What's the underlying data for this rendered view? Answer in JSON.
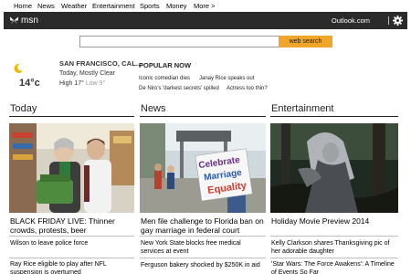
{
  "topnav": {
    "items": [
      "Home",
      "News",
      "Weather",
      "Entertainment",
      "Sports",
      "Money",
      "More >"
    ]
  },
  "header": {
    "logo_text": "msn",
    "outlook_label": "Outlook.com",
    "settings_icon": "gear-icon",
    "background_color": "#2b2b2b"
  },
  "search": {
    "placeholder": "",
    "button_label": "web search",
    "button_color": "#f0a62a"
  },
  "weather": {
    "icon": "moon-icon",
    "temperature": "14°c",
    "location": "SAN FRANCISCO, CAL...",
    "condition": "Today, Mostly Clear",
    "high": "High 17°",
    "low": "Low 9°"
  },
  "popular": {
    "title": "POPULAR NOW",
    "items": [
      "Iconic comedian dies",
      "Janay Rice speaks out",
      "De Niro's 'darkest secrets' spilled",
      "Actress too thin?"
    ]
  },
  "columns": [
    {
      "title": "Today",
      "headline": "BLACK FRIDAY LIVE: Thinner crowds, protests, beer",
      "items": [
        "Wilson to leave police force",
        "Ray Rice eligible to play after NFL suspension is overturned"
      ]
    },
    {
      "title": "News",
      "headline": "Men file challenge to Florida ban on gay marriage in federal court",
      "items": [
        "New York State blocks free medical services at event",
        "Ferguson bakery shocked by $250K in aid"
      ]
    },
    {
      "title": "Entertainment",
      "headline": "Holiday Movie Preview 2014",
      "items": [
        "Kelly Clarkson shares Thanksgiving pic of her adorable daughter",
        "'Star Wars: The Force Awakens': A Timeline of Events So Far"
      ]
    }
  ],
  "news_photo_sign": {
    "line1": "Celebrate",
    "line2": "Marriage",
    "line3": "Equality"
  }
}
